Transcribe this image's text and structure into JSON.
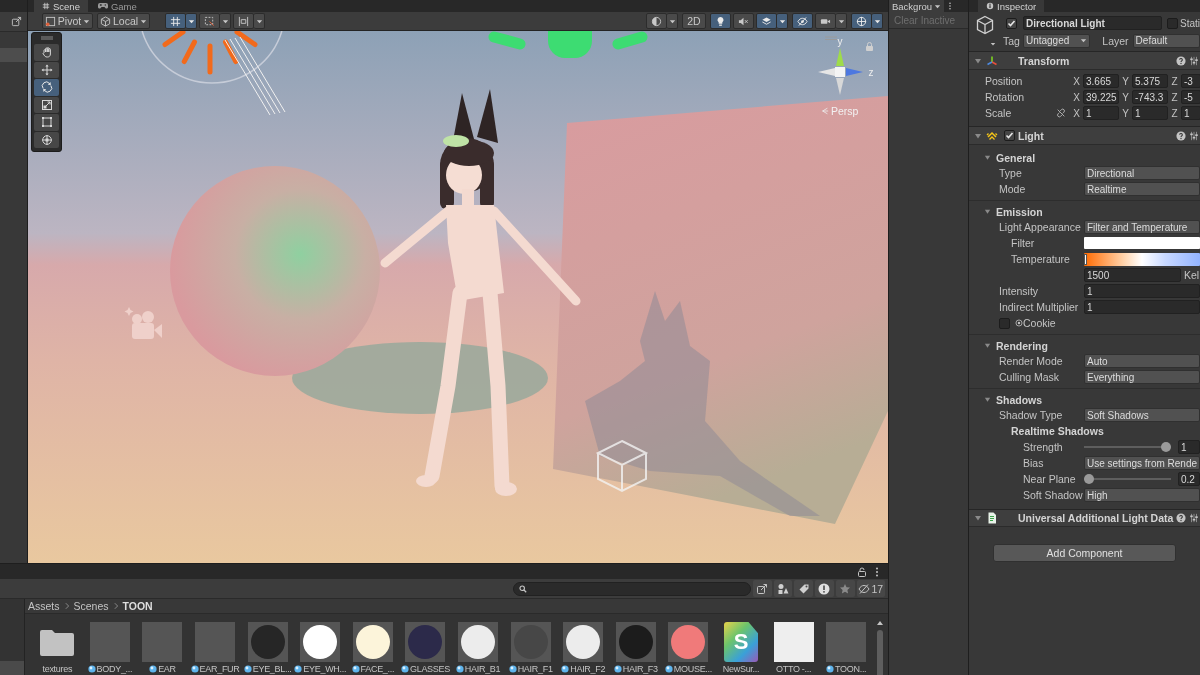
{
  "scene_view": {
    "tabs": [
      {
        "kind": "scene",
        "label": "Scene",
        "selected": true
      },
      {
        "kind": "game",
        "label": "Game",
        "selected": false
      }
    ],
    "toolbar": {
      "pivot": "Pivot",
      "space": "Local",
      "snap_buttons": [
        {
          "kind": "grid",
          "on": true
        },
        {
          "kind": "increment",
          "on": false
        },
        {
          "kind": "align",
          "on": false
        }
      ],
      "view_buttons": [
        {
          "kind": "shading",
          "on": false,
          "dropdown": true
        },
        {
          "kind": "mode",
          "label": "2D",
          "on": false,
          "dropdown": false
        },
        {
          "kind": "lighting",
          "on": true,
          "dropdown": false
        },
        {
          "kind": "audio",
          "on": false,
          "dropdown": false
        },
        {
          "kind": "effects",
          "on": true,
          "dropdown": true
        },
        {
          "kind": "visibility",
          "on": true,
          "dropdown": false
        },
        {
          "kind": "camera",
          "on": false,
          "dropdown": true
        },
        {
          "kind": "gizmos",
          "on": true,
          "dropdown": true
        }
      ]
    },
    "tools": [
      {
        "kind": "hand",
        "selected": false
      },
      {
        "kind": "move",
        "selected": false
      },
      {
        "kind": "rotate",
        "selected": true
      },
      {
        "kind": "scale",
        "selected": false
      },
      {
        "kind": "rect",
        "selected": false
      },
      {
        "kind": "transform",
        "selected": false
      }
    ],
    "orientation": {
      "up_axis": "y",
      "side_axis": "z",
      "projection": "Persp"
    }
  },
  "background_tasks": {
    "tab": "Backgrou",
    "clear_button": {
      "label": "Clear Inactive",
      "disabled": true
    }
  },
  "inspector": {
    "tab": "Inspector",
    "object": {
      "active": true,
      "name": "Directional Light",
      "static": false,
      "static_label": "Stati",
      "tag_label": "Tag",
      "tag": "Untagged",
      "layer_label": "Layer",
      "layer": "Default"
    },
    "transform": {
      "title": "Transform",
      "expanded": true,
      "rows": [
        {
          "label": "Position",
          "proportions_toggle": false,
          "axes": [
            {
              "axis": "X",
              "value": "3.665"
            },
            {
              "axis": "Y",
              "value": "5.375"
            },
            {
              "axis": "Z",
              "value": "-3"
            }
          ]
        },
        {
          "label": "Rotation",
          "proportions_toggle": false,
          "axes": [
            {
              "axis": "X",
              "value": "39.225"
            },
            {
              "axis": "Y",
              "value": "-743.3"
            },
            {
              "axis": "Z",
              "value": "-5"
            }
          ]
        },
        {
          "label": "Scale",
          "proportions_toggle": true,
          "axes": [
            {
              "axis": "X",
              "value": "1"
            },
            {
              "axis": "Y",
              "value": "1"
            },
            {
              "axis": "Z",
              "value": "1"
            }
          ]
        }
      ]
    },
    "light": {
      "title": "Light",
      "enabled": true,
      "expanded": true,
      "sections": [
        {
          "title": "General",
          "expanded": true,
          "rows": [
            {
              "kind": "dropdown",
              "label": "Type",
              "value": "Directional"
            },
            {
              "kind": "dropdown",
              "label": "Mode",
              "value": "Realtime"
            }
          ]
        },
        {
          "title": "Emission",
          "expanded": true,
          "rows": [
            {
              "kind": "dropdown",
              "label": "Light Appearance",
              "value": "Filter and Temperature",
              "children": [
                {
                  "kind": "color",
                  "label": "Filter",
                  "color": "#ffffff"
                },
                {
                  "kind": "temperature",
                  "label": "Temperature",
                  "level": 0,
                  "value": "1500",
                  "unit": "Kel"
                }
              ]
            },
            {
              "kind": "field",
              "label": "Intensity",
              "value": "1"
            },
            {
              "kind": "field",
              "label": "Indirect Multiplier",
              "value": "1"
            },
            {
              "kind": "toggle",
              "label": "Cookie",
              "checked": false
            }
          ]
        },
        {
          "title": "Rendering",
          "expanded": true,
          "rows": [
            {
              "kind": "dropdown",
              "label": "Render Mode",
              "value": "Auto"
            },
            {
              "kind": "dropdown",
              "label": "Culling Mask",
              "value": "Everything"
            }
          ]
        },
        {
          "title": "Shadows",
          "expanded": true,
          "rows": [
            {
              "kind": "dropdown",
              "label": "Shadow Type",
              "value": "Soft Shadows",
              "children": [
                {
                  "kind": "heading",
                  "label": "Realtime Shadows",
                  "children": [
                    {
                      "kind": "slider",
                      "label": "Strength",
                      "level": 1,
                      "value": "1"
                    },
                    {
                      "kind": "dropdown",
                      "label": "Bias",
                      "value": "Use settings from Rende"
                    },
                    {
                      "kind": "slider",
                      "label": "Near Plane",
                      "level": 0,
                      "value": "0.2"
                    },
                    {
                      "kind": "dropdown",
                      "label": "Soft Shadow",
                      "value": "High"
                    }
                  ]
                }
              ]
            }
          ]
        }
      ]
    },
    "extra_component": {
      "title": "Universal Additional Light Data",
      "expanded": true
    },
    "add_component": "Add Component"
  },
  "project": {
    "tool_buttons": [
      {
        "kind": "open-search"
      },
      {
        "kind": "type"
      },
      {
        "kind": "label"
      },
      {
        "kind": "warning"
      },
      {
        "kind": "favorite"
      },
      {
        "kind": "hidden",
        "count": "17"
      }
    ],
    "breadcrumb": [
      {
        "label": "Assets",
        "current": false
      },
      {
        "label": "Scenes",
        "current": false
      },
      {
        "label": "TOON",
        "current": true
      }
    ],
    "assets": [
      {
        "kind": "folder",
        "name": "textures"
      },
      {
        "kind": "material",
        "name": "BODY_..."
      },
      {
        "kind": "material",
        "name": "EAR"
      },
      {
        "kind": "material",
        "name": "EAR_FUR"
      },
      {
        "kind": "material",
        "name": "EYE_BL...",
        "color": "#262626"
      },
      {
        "kind": "material",
        "name": "EYE_WH...",
        "color": "#ffffff"
      },
      {
        "kind": "material",
        "name": "FACE_...",
        "color": "#fcf4da"
      },
      {
        "kind": "material",
        "name": "GLASSES",
        "color": "#2c2a4a"
      },
      {
        "kind": "material",
        "name": "HAIR_B1",
        "color": "#ececec"
      },
      {
        "kind": "material",
        "name": "HAIR_F1",
        "color": "#474747"
      },
      {
        "kind": "material",
        "name": "HAIR_F2",
        "color": "#ececec"
      },
      {
        "kind": "material",
        "name": "HAIR_F3",
        "color": "#1c1c1c"
      },
      {
        "kind": "material",
        "name": "MOUSE...",
        "color": "#f07a7a"
      },
      {
        "kind": "shader",
        "name": "NewSur...",
        "letter": "S"
      },
      {
        "kind": "image",
        "name": "OTTO -..."
      },
      {
        "kind": "material",
        "name": "TOON..."
      }
    ]
  }
}
